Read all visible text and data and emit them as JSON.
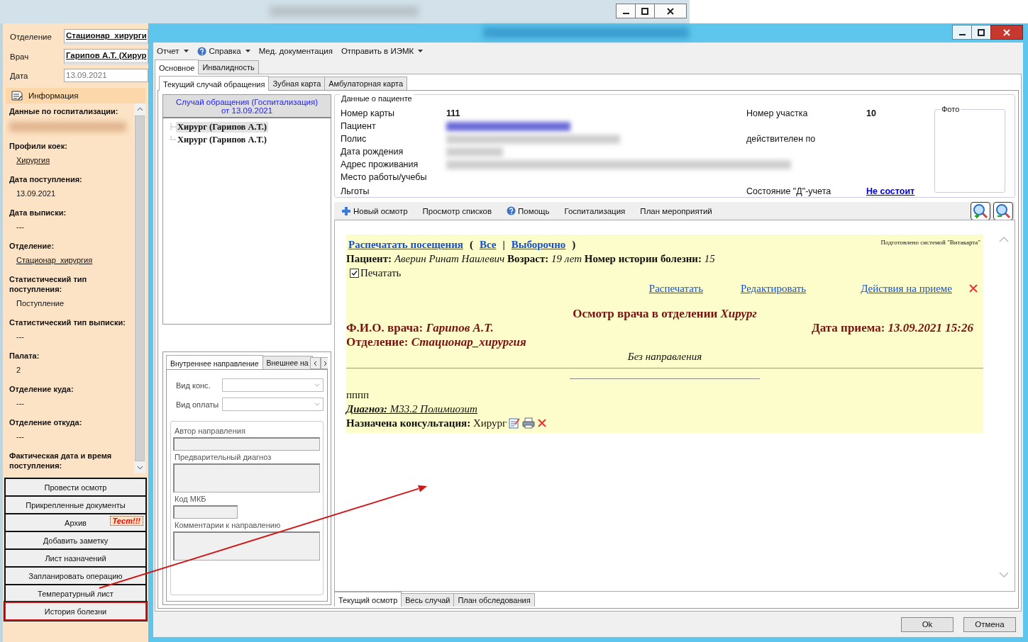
{
  "back_window": {
    "fields": [
      {
        "label": "Отделение",
        "value": "Стационар_хирурги",
        "kind": "combo"
      },
      {
        "label": "Врач",
        "value": "Гарипов А.Т. (Хирур",
        "kind": "combo"
      },
      {
        "label": "Дата",
        "value": "13.09.2021",
        "kind": "date"
      }
    ],
    "info": {
      "title": "Информация",
      "sections": [
        {
          "heading": "Данные по госпитализации:",
          "kind": "redacted"
        },
        {
          "heading": "Профили коек:",
          "value": "Хирургия",
          "kind": "link"
        },
        {
          "heading": "Дата поступления:",
          "value": "13.09.2021",
          "kind": "text"
        },
        {
          "heading": "Дата выписки:",
          "value": "---",
          "kind": "text"
        },
        {
          "heading": "Отделение:",
          "value": "Стационар_хирургия",
          "kind": "link"
        },
        {
          "heading": "Статистический тип поступления:",
          "value": "Поступление",
          "kind": "text"
        },
        {
          "heading": "Статистический тип выписки:",
          "value": "---",
          "kind": "text"
        },
        {
          "heading": "Палата:",
          "value": "2",
          "kind": "text"
        },
        {
          "heading": "Отделение куда:",
          "value": "---",
          "kind": "text"
        },
        {
          "heading": "Отделение откуда:",
          "value": "---",
          "kind": "text"
        },
        {
          "heading": "Фактическая дата и время поступления:",
          "kind": "text"
        }
      ]
    },
    "buttons": [
      {
        "label": "Провести осмотр",
        "highlighted": false
      },
      {
        "label": "Прикрепленные документы",
        "highlighted": false
      },
      {
        "label": "Архив",
        "badge": "Тест!!!",
        "highlighted": false
      },
      {
        "label": "Добавить заметку",
        "highlighted": false
      },
      {
        "label": "Лист назначений",
        "highlighted": false
      },
      {
        "label": "Запланировать операцию",
        "highlighted": false
      },
      {
        "label": "Температурный лист",
        "highlighted": false
      },
      {
        "label": "История болезни",
        "highlighted": true
      }
    ]
  },
  "front_window": {
    "menu": [
      {
        "label": "Отчет",
        "dropdown": true,
        "kind": "plain"
      },
      {
        "label": "Справка",
        "dropdown": true,
        "kind": "help"
      },
      {
        "label": "Мед. документация",
        "dropdown": false,
        "kind": "plain"
      },
      {
        "label": "Отправить в ИЭМК",
        "dropdown": true,
        "kind": "plain"
      }
    ],
    "tabs": [
      {
        "label": "Основное",
        "selected": true
      },
      {
        "label": "Инвалидность",
        "selected": false
      }
    ],
    "subtabs": [
      {
        "label": "Текущий случай обращения",
        "selected": true
      },
      {
        "label": "Зубная карта",
        "selected": false
      },
      {
        "label": "Амбулаторная карта",
        "selected": false
      }
    ],
    "case": {
      "title": "Случай обращения (Госпитализация)",
      "date": "от 13.09.2021"
    },
    "tree": [
      {
        "label": "Хирург (Гарипов А.Т.)",
        "selected": true
      },
      {
        "label": "Хирург (Гарипов А.Т.)",
        "selected": false
      }
    ],
    "referral": {
      "tabs": [
        {
          "label": "Внутреннее направление",
          "selected": true
        },
        {
          "label": "Внешнее на",
          "selected": false
        }
      ],
      "fields": [
        {
          "label": "Вид конс.",
          "kind": "combo"
        },
        {
          "label": "Вид оплаты",
          "kind": "combo"
        }
      ],
      "group": [
        {
          "label": "Автор направления",
          "kind": "line"
        },
        {
          "label": "Предварительный диагноз",
          "kind": "area"
        },
        {
          "label": "Код МКБ",
          "kind": "short"
        },
        {
          "label": "Комментарии к направлению",
          "kind": "area"
        }
      ]
    },
    "patient": {
      "title": "Данные о пациенте",
      "photo_label": "Фото",
      "rows": [
        {
          "label": "Номер карты",
          "value": "111",
          "kind": "text",
          "right": {
            "label": "Номер участка",
            "value": "10",
            "kind": "text"
          }
        },
        {
          "label": "Пациент",
          "kind": "redacted_blue"
        },
        {
          "label": "Полис",
          "kind": "redacted",
          "right": {
            "label": "действителен по",
            "kind": "text"
          }
        },
        {
          "label": "Дата рождения",
          "kind": "redacted_short"
        },
        {
          "label": "Адрес проживания",
          "kind": "redacted_wide"
        },
        {
          "label": "Место работы/учебы",
          "kind": "empty"
        },
        {
          "label": "Льготы",
          "kind": "empty",
          "right": {
            "label": "Состояние \"Д\"-учета",
            "value": "Не состоит",
            "kind": "link"
          }
        }
      ]
    },
    "toolbar": [
      {
        "label": "Новый осмотр",
        "kind": "add"
      },
      {
        "label": "Просмотр списков",
        "kind": "plain"
      },
      {
        "label": "Помощь",
        "kind": "help"
      },
      {
        "label": "Госпитализация",
        "kind": "plain"
      },
      {
        "label": "План мероприятий",
        "kind": "plain"
      }
    ],
    "document": {
      "print_line": [
        {
          "text": "Распечатать посещения",
          "kind": "link"
        },
        {
          "text": "(",
          "kind": "text"
        },
        {
          "text": "Все",
          "kind": "link"
        },
        {
          "text": "|",
          "kind": "text"
        },
        {
          "text": "Выборочно",
          "kind": "link"
        },
        {
          "text": ")",
          "kind": "text"
        }
      ],
      "credit": "Подготовлено системой \"Витакарта\"",
      "patient_line": "**Пациент:** *Аверин Ринат Наилевич* **Возраст:** *19 лет* **Номер истории болезни:** *15*",
      "print_checkbox": {
        "label": "Печатать",
        "checked": true
      },
      "actions": [
        "Распечатать",
        "Редактировать",
        "Действия на приеме"
      ],
      "exam_title": "Осмотр врача в отделении *Хирург*",
      "doctor_line": "Ф.И.О. врача: *Гарипов А.Т.*",
      "date_line": "Дата приема: *13.09.2021 15:26*",
      "department_line": "Отделение: *Стационар_хирургия*",
      "referral_note": "Без направления",
      "note": "пппп",
      "diagnosis": "**Диагноз:** М33.2 Полимиозит",
      "consultation": "**Назначена консультация:** Хирург"
    },
    "bottom_tabs": [
      {
        "label": "Текущий осмотр",
        "selected": true
      },
      {
        "label": "Весь случай",
        "selected": false
      },
      {
        "label": "План обследования",
        "selected": false
      }
    ],
    "buttons": [
      "Ok",
      "Отмена"
    ]
  }
}
